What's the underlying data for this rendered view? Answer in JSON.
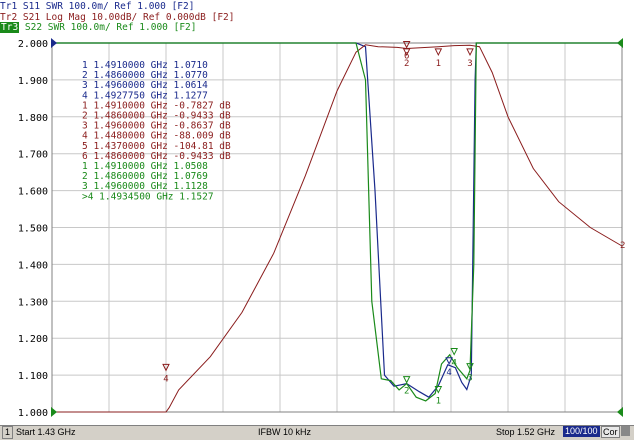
{
  "header": {
    "tr1": "Tr1 S11 SWR 100.0m/ Ref 1.000 [F2]",
    "tr2": "Tr2 S21 Log Mag 10.00dB/ Ref 0.000dB [F2]",
    "tr3_tag": "Tr3",
    "tr3_rest": " S22 SWR 100.0m/ Ref 1.000 [F2]"
  },
  "colors": {
    "tr1": "#1a2a8c",
    "tr2": "#8a1c1c",
    "tr3": "#1a8a1a",
    "grid": "#c8c8c8"
  },
  "chart_data": {
    "type": "line",
    "x_range_ghz": [
      1.43,
      1.52
    ],
    "ylim": [
      1.0,
      2.0
    ],
    "y_ticks": [
      "2.000",
      "1.900",
      "1.800",
      "1.700",
      "1.600",
      "1.500",
      "1.400",
      "1.300",
      "1.200",
      "1.100",
      "1.000"
    ],
    "series": [
      {
        "name": "Tr1",
        "x": [
          1.43,
          1.478,
          1.4795,
          1.481,
          1.4825,
          1.484,
          1.486,
          1.488,
          1.4895,
          1.491,
          1.4925,
          1.4937,
          1.4947,
          1.4955,
          1.4962,
          1.4965,
          1.4968,
          1.497,
          1.52
        ],
        "y": [
          2.0,
          2.0,
          1.99,
          1.6,
          1.1,
          1.07,
          1.077,
          1.055,
          1.04,
          1.071,
          1.128,
          1.12,
          1.08,
          1.061,
          1.1,
          1.5,
          1.9,
          2.0,
          2.0
        ]
      },
      {
        "name": "Tr2",
        "x": [
          1.43,
          1.448,
          1.4485,
          1.45,
          1.455,
          1.46,
          1.465,
          1.47,
          1.475,
          1.478,
          1.4795,
          1.4815,
          1.4845,
          1.486,
          1.491,
          1.4935,
          1.496,
          1.4975,
          1.4995,
          1.502,
          1.506,
          1.51,
          1.515,
          1.52
        ],
        "y": [
          1.0,
          1.0,
          1.012,
          1.06,
          1.15,
          1.27,
          1.43,
          1.64,
          1.87,
          1.975,
          1.995,
          1.99,
          1.988,
          1.985,
          1.99,
          1.993,
          1.994,
          1.99,
          1.92,
          1.8,
          1.66,
          1.57,
          1.5,
          1.45
        ]
      },
      {
        "name": "Tr3",
        "x": [
          1.43,
          1.478,
          1.4795,
          1.4805,
          1.482,
          1.4835,
          1.4848,
          1.486,
          1.4875,
          1.489,
          1.4905,
          1.4915,
          1.4928,
          1.494,
          1.4955,
          1.496,
          1.4966,
          1.497,
          1.52
        ],
        "y": [
          2.0,
          2.0,
          1.9,
          1.3,
          1.09,
          1.085,
          1.06,
          1.077,
          1.04,
          1.03,
          1.05,
          1.13,
          1.155,
          1.12,
          1.09,
          1.113,
          1.4,
          2.0,
          2.0
        ]
      }
    ],
    "markers_table": [
      {
        "text": "1  1.4910000 GHz  1.0710",
        "color": "#1a2a8c"
      },
      {
        "text": "2  1.4860000 GHz  1.0770",
        "color": "#1a2a8c"
      },
      {
        "text": "3  1.4960000 GHz  1.0614",
        "color": "#1a2a8c"
      },
      {
        "text": "4  1.4927750 GHz  1.1277",
        "color": "#1a2a8c"
      },
      {
        "text": "1  1.4910000 GHz -0.7827 dB",
        "color": "#8a1c1c"
      },
      {
        "text": "2  1.4860000 GHz -0.9433 dB",
        "color": "#8a1c1c"
      },
      {
        "text": "3  1.4960000 GHz -0.8637 dB",
        "color": "#8a1c1c"
      },
      {
        "text": "4  1.4480000 GHz -88.009 dB",
        "color": "#8a1c1c"
      },
      {
        "text": "5  1.4370000 GHz -104.81 dB",
        "color": "#8a1c1c"
      },
      {
        "text": "6  1.4860000 GHz -0.9433 dB",
        "color": "#8a1c1c"
      },
      {
        "text": "1  1.4910000 GHz  1.0508",
        "color": "#1a8a1a"
      },
      {
        "text": "2  1.4860000 GHz  1.0769",
        "color": "#1a8a1a"
      },
      {
        "text": "3  1.4960000 GHz  1.1128",
        "color": "#1a8a1a"
      },
      {
        "text": ">4 1.4934500 GHz  1.1527",
        "color": "#1a8a1a"
      }
    ],
    "marker_labels": [
      {
        "label": "6",
        "x": 1.486,
        "y": 1.985,
        "color": "#8a1c1c"
      },
      {
        "label": "2",
        "x": 1.486,
        "y": 1.965,
        "color": "#8a1c1c"
      },
      {
        "label": "1",
        "x": 1.491,
        "y": 1.965,
        "color": "#8a1c1c"
      },
      {
        "label": "3",
        "x": 1.496,
        "y": 1.965,
        "color": "#8a1c1c"
      },
      {
        "label": "4",
        "x": 1.448,
        "y": 1.11,
        "color": "#8a1c1c"
      },
      {
        "label": "2",
        "x": 1.486,
        "y": 1.077,
        "color": "#1a8a1a"
      },
      {
        "label": "1",
        "x": 1.491,
        "y": 1.05,
        "color": "#1a8a1a"
      },
      {
        "label": "4",
        "x": 1.4935,
        "y": 1.153,
        "color": "#1a8a1a"
      },
      {
        "label": "3",
        "x": 1.496,
        "y": 1.112,
        "color": "#1a8a1a"
      },
      {
        "label": "4",
        "x": 1.4927,
        "y": 1.128,
        "color": "#1a2a8c"
      }
    ],
    "right_label": {
      "text": "2",
      "color": "#8a1c1c"
    }
  },
  "status": {
    "channel": "1",
    "start": "Start 1.43 GHz",
    "ifbw": "IFBW 10 kHz",
    "stop": "Stop 1.52 GHz",
    "avg": "100/100",
    "cor": "Cor"
  }
}
